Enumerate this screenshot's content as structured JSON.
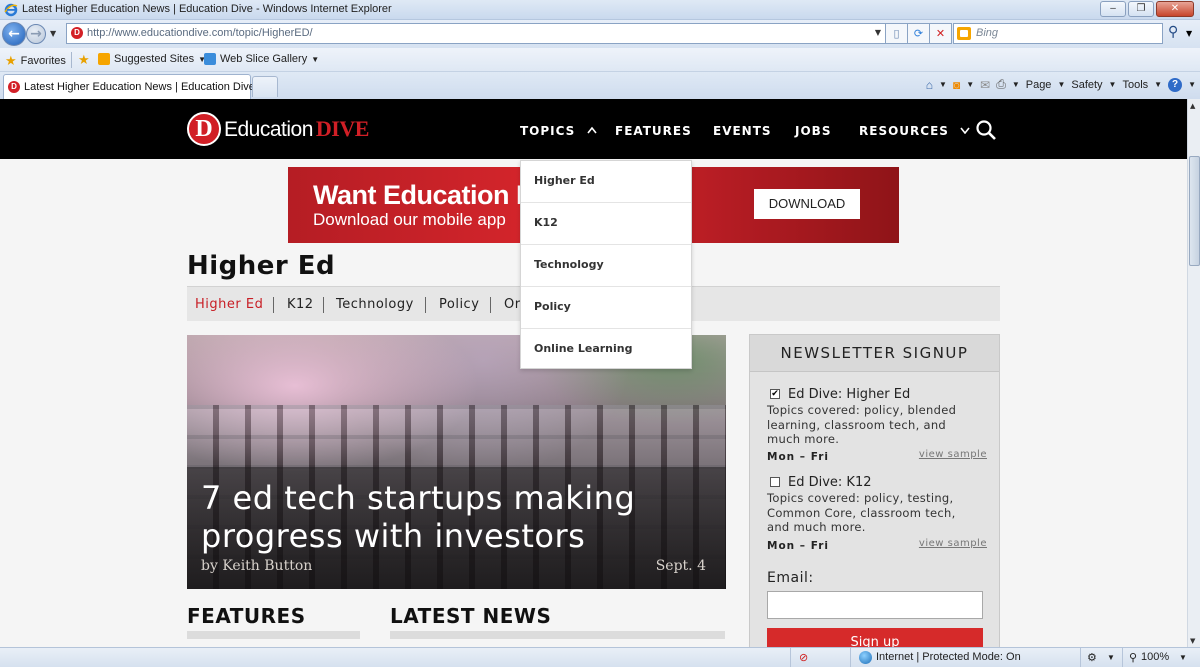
{
  "window": {
    "title": "Latest Higher Education News | Education Dive - Windows Internet Explorer",
    "min": "–",
    "max": "❐",
    "close": "✕"
  },
  "address_bar": {
    "url": "http://www.educationdive.com/topic/HigherED/",
    "search_placeholder": "Bing"
  },
  "favorites_bar": {
    "favorites_label": "Favorites",
    "items": [
      "Suggested Sites",
      "Web Slice Gallery"
    ]
  },
  "tab": {
    "label": "Latest Higher Education News | Education Dive"
  },
  "command_bar": {
    "page_label": "Page",
    "safety_label": "Safety",
    "tools_label": "Tools"
  },
  "site": {
    "logo_letter": "D",
    "logo_text": "Education",
    "logo_dive": "DIVE",
    "nav": {
      "topics": "TOPICS",
      "features": "FEATURES",
      "events": "EVENTS",
      "jobs": "JOBS",
      "resources": "RESOURCES"
    },
    "topics_menu": [
      "Higher Ed",
      "K12",
      "Technology",
      "Policy",
      "Online Learning"
    ],
    "banner": {
      "headline": "Want Education Dive",
      "sub": "Download our mobile app",
      "button": "DOWNLOAD"
    },
    "page_title": "Higher Ed",
    "subnav": [
      "Higher Ed",
      "K12",
      "Technology",
      "Policy",
      "Or"
    ],
    "hero": {
      "headline": "7 ed tech startups making progress with investors",
      "author": "by Keith Button",
      "date": "Sept. 4"
    },
    "sections": {
      "features": "FEATURES",
      "latest_news": "LATEST NEWS"
    },
    "newsletter": {
      "title": "NEWSLETTER SIGNUP",
      "options": [
        {
          "name": "Ed Dive: Higher Ed",
          "checked": true,
          "desc": "Topics covered: policy, blended learning, classroom tech, and much more.",
          "freq": "Mon – Fri",
          "sample": "view sample"
        },
        {
          "name": "Ed Dive: K12",
          "checked": false,
          "desc": "Topics covered: policy, testing, Common Core, classroom tech, and much more.",
          "freq": "Mon – Fri",
          "sample": "view sample"
        }
      ],
      "email_label": "Email:",
      "email_value": "",
      "button": "Sign up"
    }
  },
  "status_bar": {
    "zone": "Internet | Protected Mode: On",
    "zoom": "100%"
  },
  "colors": {
    "brand_red": "#d11f26",
    "header_black": "#000000",
    "active_link": "#c81e25"
  }
}
